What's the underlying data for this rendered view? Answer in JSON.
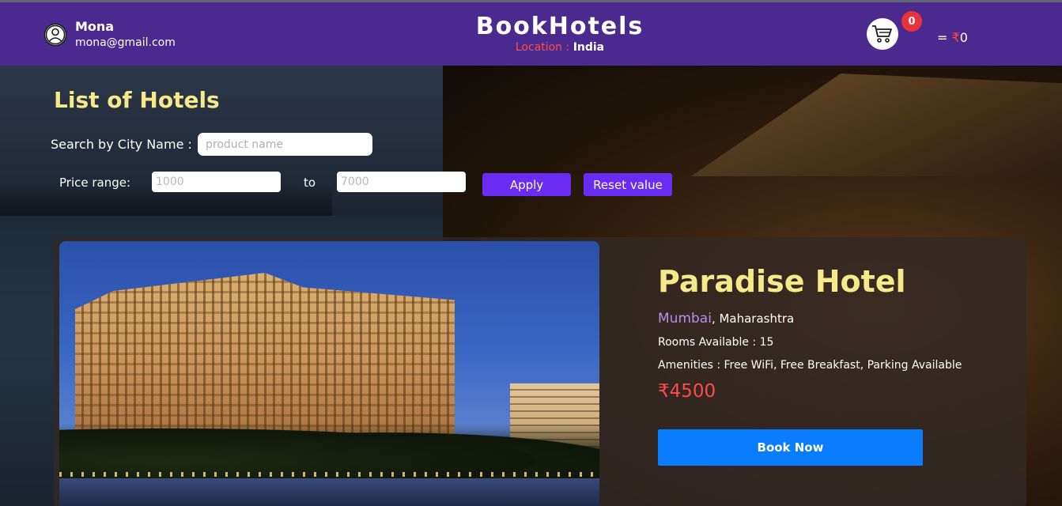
{
  "header": {
    "user_name": "Mona",
    "user_email": "mona@gmail.com",
    "brand": "BookHotels",
    "location_label": "Location :",
    "location_value": "India",
    "cart_count": "0",
    "cart_total_prefix": "=",
    "cart_currency": "₹",
    "cart_total": "0",
    "icons": [
      "user-circle-icon",
      "cart-icon"
    ]
  },
  "filters": {
    "title": "List of Hotels",
    "search_label": "Search by City Name :",
    "search_placeholder": "product name",
    "price_label": "Price range:",
    "price_min_placeholder": "1000",
    "to_label": "to",
    "price_max_placeholder": "7000",
    "apply_label": "Apply",
    "reset_label": "Reset value"
  },
  "hotels": [
    {
      "name": "Paradise Hotel",
      "city": "Mumbai",
      "state": ", Maharashtra",
      "rooms": "Rooms Available : 15",
      "amenities": "Amenities : Free WiFi, Free Breakfast, Parking Available",
      "price": "₹4500",
      "book_label": "Book Now"
    }
  ],
  "colors": {
    "header_bg": "#4b2a8f",
    "accent_purple": "#6a2bf2",
    "title_yellow": "#f5e98a",
    "price_red": "#ff4a4a",
    "book_blue": "#0a7cff",
    "badge_red": "#e8333a"
  }
}
